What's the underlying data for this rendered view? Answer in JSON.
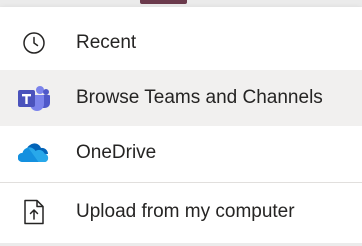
{
  "menu": {
    "items": [
      {
        "label": "Recent",
        "icon": "clock-icon"
      },
      {
        "label": "Browse Teams and Channels",
        "icon": "teams-icon",
        "highlighted": true
      },
      {
        "label": "OneDrive",
        "icon": "onedrive-icon"
      },
      {
        "label": "Upload from my computer",
        "icon": "upload-file-icon"
      }
    ]
  },
  "colors": {
    "text": "#252423",
    "hover_background": "#f1f0ef",
    "teams_purple": "#5b5fc7",
    "onedrive_blue": "#0f78d4",
    "divider": "#e1dfdd"
  }
}
